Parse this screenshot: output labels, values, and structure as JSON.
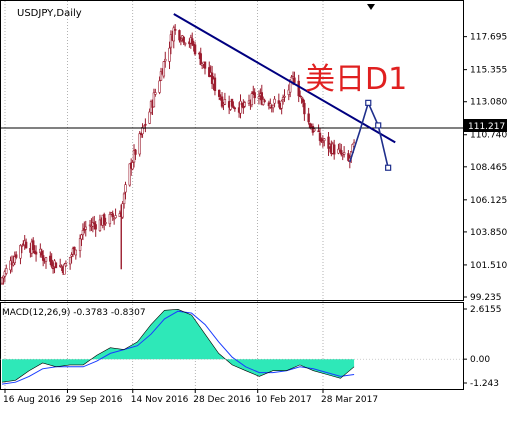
{
  "symbol_label": "USDJPY,Daily",
  "overlay_label": "美日D1",
  "macd_label": "MACD(12,26,9) -0.3783 -0.8307",
  "colors": {
    "candles": "#9b1c2e",
    "trendline": "#000080",
    "projection": "#1f2f8c",
    "macd_hist": "#2ee8b8",
    "signal": "#1a3cff",
    "overlay_text": "#e02020",
    "hline": "#000000",
    "grid": "#808080"
  },
  "chart_data": [
    {
      "type": "candlestick",
      "title": "USDJPY,Daily",
      "x_tick_labels": [
        "16 Aug 2016",
        "29 Sep 2016",
        "14 Nov 2016",
        "28 Dec 2016",
        "10 Feb 2017",
        "28 Mar 2017"
      ],
      "y_tick_labels": [
        "117.695",
        "115.355",
        "113.080",
        "110.740",
        "108.465",
        "106.125",
        "103.850",
        "101.510",
        "99.235"
      ],
      "y_range": [
        99.235,
        119.3
      ],
      "current_price_label": "111.217",
      "current_price": 111.217,
      "grid": "vertical dotted",
      "close_series": [
        {
          "date": "2016-08-16",
          "close": 100.6
        },
        {
          "date": "2016-08-31",
          "close": 103.2
        },
        {
          "date": "2016-09-15",
          "close": 102.0
        },
        {
          "date": "2016-09-29",
          "close": 101.3
        },
        {
          "date": "2016-10-14",
          "close": 104.2
        },
        {
          "date": "2016-10-31",
          "close": 104.8
        },
        {
          "date": "2016-11-08",
          "close": 105.3
        },
        {
          "date": "2016-11-14",
          "close": 108.4
        },
        {
          "date": "2016-11-28",
          "close": 112.4
        },
        {
          "date": "2016-12-15",
          "close": 118.2
        },
        {
          "date": "2016-12-28",
          "close": 117.2
        },
        {
          "date": "2017-01-06",
          "close": 115.5
        },
        {
          "date": "2017-01-18",
          "close": 113.2
        },
        {
          "date": "2017-02-03",
          "close": 112.6
        },
        {
          "date": "2017-02-10",
          "close": 113.5
        },
        {
          "date": "2017-02-28",
          "close": 112.8
        },
        {
          "date": "2017-03-10",
          "close": 114.8
        },
        {
          "date": "2017-03-20",
          "close": 111.6
        },
        {
          "date": "2017-03-28",
          "close": 110.4
        },
        {
          "date": "2017-04-11",
          "close": 109.4
        },
        {
          "date": "2017-04-17",
          "close": 108.8
        },
        {
          "date": "2017-04-21",
          "close": 109.9
        }
      ],
      "trendline": [
        {
          "date": "2016-12-15",
          "price": 119.3
        },
        {
          "date": "2017-05-20",
          "price": 110.2
        }
      ],
      "projection_path": [
        {
          "date": "2017-04-18",
          "price": 108.8
        },
        {
          "date": "2017-04-25",
          "price": 111.0
        },
        {
          "date": "2017-05-01",
          "price": 113.0
        },
        {
          "date": "2017-05-08",
          "price": 111.4
        },
        {
          "date": "2017-05-15",
          "price": 108.4
        }
      ]
    },
    {
      "type": "area",
      "title": "MACD(12,26,9) -0.3783 -0.8307",
      "y_tick_labels": [
        "2.6155",
        "0.00",
        "-1.243"
      ],
      "y_range": [
        -1.243,
        2.6155
      ],
      "series": [
        {
          "name": "MACD",
          "kind": "histogram",
          "values": [
            -1.2,
            -1.1,
            -0.6,
            -0.2,
            -0.4,
            -0.3,
            -0.3,
            0.2,
            0.6,
            0.5,
            0.9,
            1.8,
            2.55,
            2.6,
            2.3,
            1.3,
            0.3,
            -0.3,
            -0.6,
            -0.9,
            -0.6,
            -0.6,
            -0.3,
            -0.6,
            -0.8,
            -1.0,
            -0.4
          ]
        },
        {
          "kind": "line",
          "values": [
            -1.3,
            -1.2,
            -0.9,
            -0.5,
            -0.4,
            -0.4,
            -0.4,
            -0.1,
            0.3,
            0.5,
            0.7,
            1.3,
            2.1,
            2.5,
            2.4,
            1.8,
            0.9,
            0.1,
            -0.4,
            -0.7,
            -0.7,
            -0.6,
            -0.4,
            -0.5,
            -0.7,
            -0.9,
            -0.8
          ]
        }
      ]
    }
  ]
}
